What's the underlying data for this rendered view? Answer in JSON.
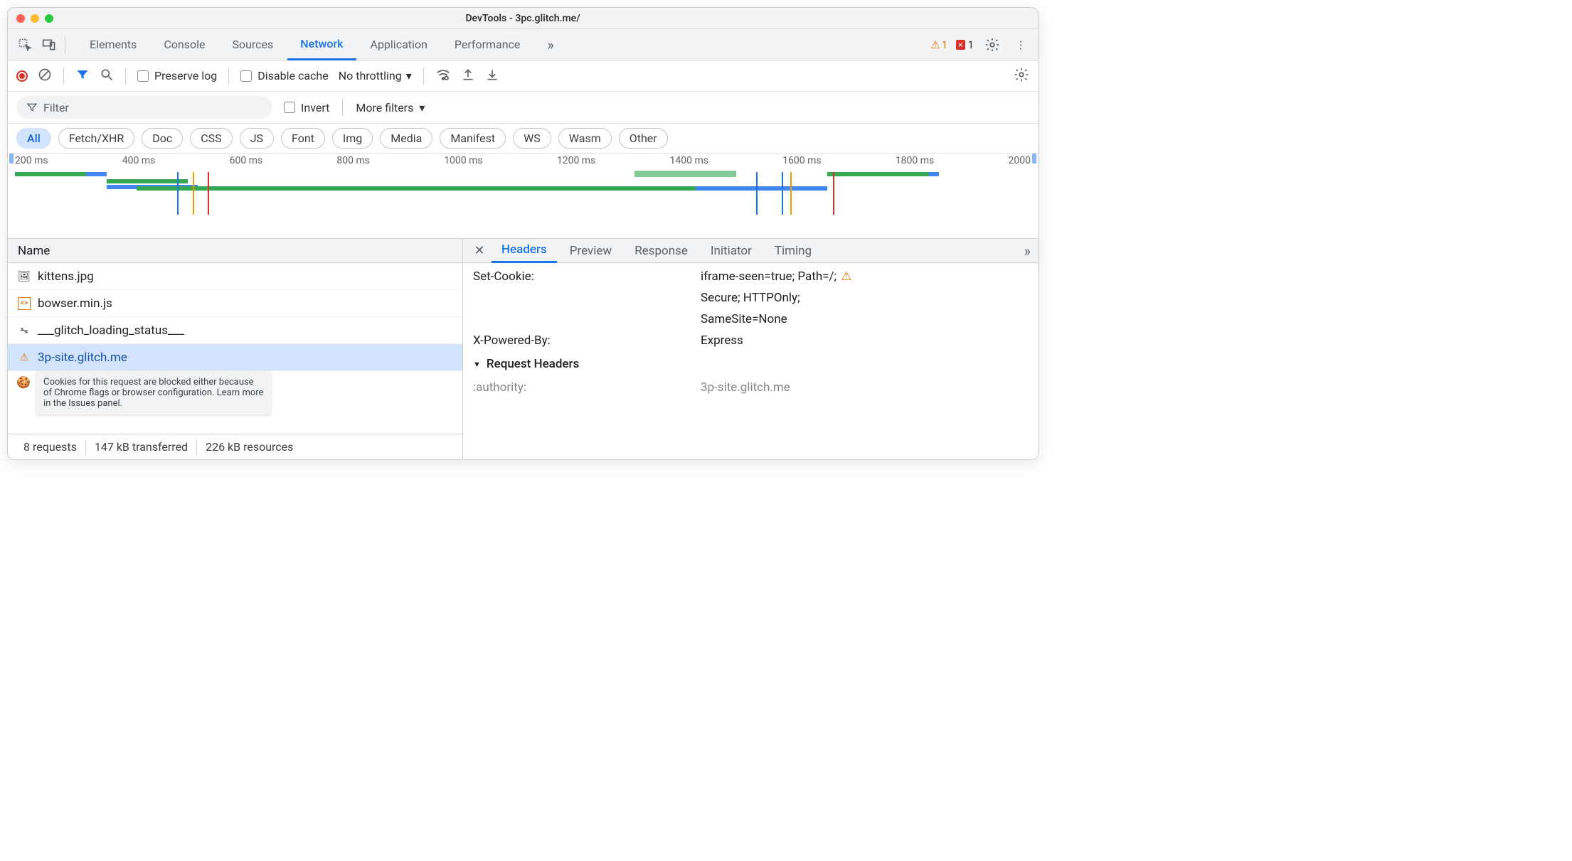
{
  "window": {
    "title": "DevTools - 3pc.glitch.me/"
  },
  "tabs": {
    "items": [
      "Elements",
      "Console",
      "Sources",
      "Network",
      "Application",
      "Performance"
    ],
    "active": "Network",
    "warn_count": "1",
    "err_count": "1"
  },
  "toolbar": {
    "preserve_log": "Preserve log",
    "disable_cache": "Disable cache",
    "throttling": "No throttling"
  },
  "filterbar": {
    "placeholder": "Filter",
    "invert": "Invert",
    "more_filters": "More filters"
  },
  "chips": {
    "all": "All",
    "items": [
      "Fetch/XHR",
      "Doc",
      "CSS",
      "JS",
      "Font",
      "Img",
      "Media",
      "Manifest",
      "WS",
      "Wasm",
      "Other"
    ]
  },
  "timeline": {
    "ticks": [
      "200 ms",
      "400 ms",
      "600 ms",
      "800 ms",
      "1000 ms",
      "1200 ms",
      "1400 ms",
      "1600 ms",
      "1800 ms",
      "2000 "
    ]
  },
  "requests": {
    "header": "Name",
    "rows": [
      {
        "icon": "img",
        "name": "kittens.jpg"
      },
      {
        "icon": "js",
        "name": "bowser.min.js"
      },
      {
        "icon": "ws",
        "name": "___glitch_loading_status___"
      },
      {
        "icon": "warn",
        "name": "3p-site.glitch.me",
        "selected": true
      }
    ],
    "tooltip": "Cookies for this request are blocked either because of Chrome flags or browser configuration. Learn more in the Issues panel."
  },
  "status": {
    "requests": "8 requests",
    "transferred": "147 kB transferred",
    "resources": "226 kB resources"
  },
  "details": {
    "tabs": [
      "Headers",
      "Preview",
      "Response",
      "Initiator",
      "Timing"
    ],
    "active": "Headers",
    "set_cookie_label": "Set-Cookie:",
    "set_cookie_v1": "iframe-seen=true; Path=/;",
    "set_cookie_v2": "Secure; HTTPOnly;",
    "set_cookie_v3": "SameSite=None",
    "xpb_label": "X-Powered-By:",
    "xpb_value": "Express",
    "req_headers": "Request Headers",
    "authority_label": ":authority:",
    "authority_value": "3p-site.glitch.me"
  }
}
